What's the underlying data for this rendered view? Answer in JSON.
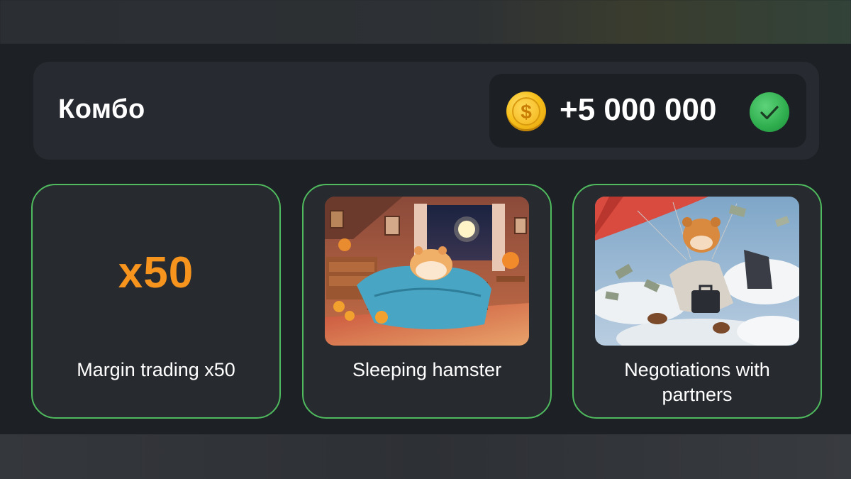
{
  "combo": {
    "title": "Комбо",
    "reward": "+5 000 000",
    "coin_icon": "dollar-coin-icon",
    "coin_symbol": "$",
    "status_icon": "check-circle-icon",
    "status_color": "#2fae4e"
  },
  "cards": [
    {
      "label": "Margin trading x50",
      "multiplier": "x50"
    },
    {
      "label": "Sleeping hamster",
      "image": "sleeping-hamster-image"
    },
    {
      "label": "Negotiations with partners",
      "image": "hamster-parachute-image"
    }
  ],
  "colors": {
    "accent_green": "#4fbb5e",
    "multiplier_orange": "#f7941d"
  }
}
